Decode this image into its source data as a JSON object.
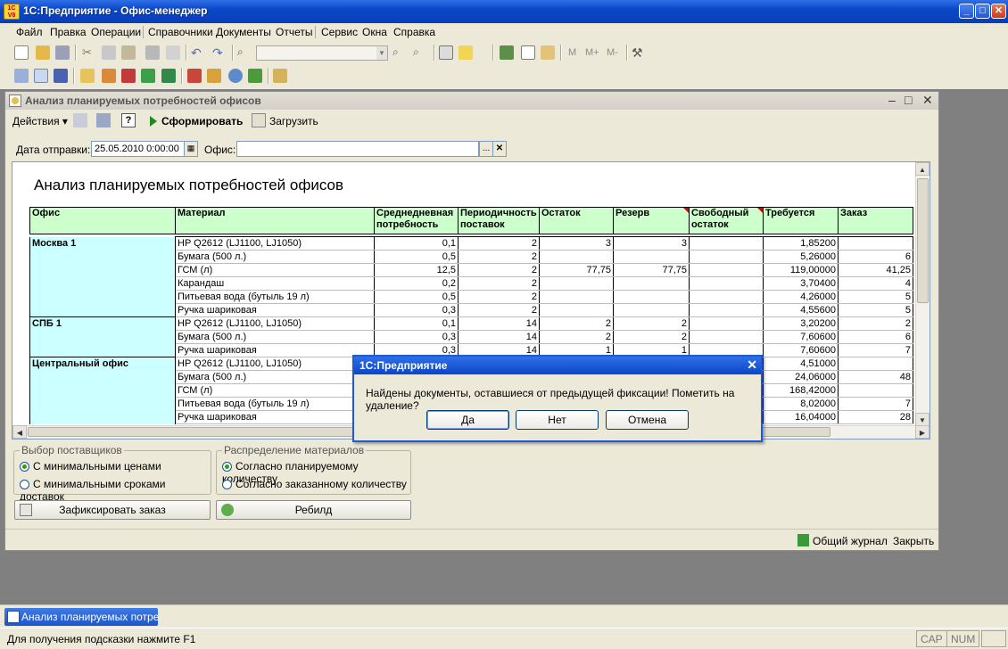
{
  "app": {
    "title": "1С:Предприятие - Офис-менеджер",
    "icon_text": "1С V8"
  },
  "menu": [
    "Файл",
    "Правка",
    "Операции",
    "Справочники",
    "Документы",
    "Отчеты",
    "Сервис",
    "Окна",
    "Справка"
  ],
  "toolbar": {
    "m_labels": [
      "M",
      "M+",
      "M-"
    ]
  },
  "window": {
    "title": "Анализ планируемых потребностей офисов",
    "toolbar": {
      "actions": "Действия",
      "generate": "Сформировать",
      "load": "Загрузить",
      "help": "?"
    },
    "filters": {
      "date_label": "Дата отправки:",
      "date_value": "25.05.2010  0:00:00",
      "office_label": "Офис:",
      "office_value": ""
    }
  },
  "report": {
    "title": "Анализ планируемых потребностей офисов",
    "columns": [
      "Офис",
      "Материал",
      "Среднедневная потребность",
      "Периодичность поставок",
      "Остаток",
      "Резерв",
      "Свободный остаток",
      "Требуется",
      "Заказ"
    ],
    "rows": [
      {
        "office": "Москва 1",
        "cells": [
          "HP Q2612 (LJ1100, LJ1050)",
          "0,1",
          "2",
          "3",
          "3",
          "",
          "1,85200",
          ""
        ]
      },
      {
        "office": "",
        "cells": [
          "Бумага (500 л.)",
          "0,5",
          "2",
          "",
          "",
          "",
          "5,26000",
          "6"
        ]
      },
      {
        "office": "",
        "cells": [
          "ГСМ (л)",
          "12,5",
          "2",
          "77,75",
          "77,75",
          "",
          "119,00000",
          "41,25"
        ]
      },
      {
        "office": "",
        "cells": [
          "Карандаш",
          "0,2",
          "2",
          "",
          "",
          "",
          "3,70400",
          "4"
        ]
      },
      {
        "office": "",
        "cells": [
          "Питьевая вода (бутыль 19 л)",
          "0,5",
          "2",
          "",
          "",
          "",
          "4,26000",
          "5"
        ]
      },
      {
        "office": "",
        "cells": [
          "Ручка шариковая",
          "0,3",
          "2",
          "",
          "",
          "",
          "4,55600",
          "5"
        ]
      },
      {
        "office": "СПБ 1",
        "cells": [
          "HP Q2612 (LJ1100, LJ1050)",
          "0,1",
          "14",
          "2",
          "2",
          "",
          "3,20200",
          "2"
        ]
      },
      {
        "office": "",
        "cells": [
          "Бумага (500 л.)",
          "0,3",
          "14",
          "2",
          "2",
          "",
          "7,60600",
          "6"
        ]
      },
      {
        "office": "",
        "cells": [
          "Ручка шариковая",
          "0,3",
          "14",
          "1",
          "1",
          "",
          "7,60600",
          "7"
        ]
      },
      {
        "office": "Центральный офис",
        "cells": [
          "HP Q2612 (LJ1100, LJ1050)",
          "",
          "",
          "",
          "",
          "",
          "4,51000",
          ""
        ]
      },
      {
        "office": "",
        "cells": [
          "Бумага (500 л.)",
          "",
          "",
          "",
          "",
          "",
          "24,06000",
          "48"
        ]
      },
      {
        "office": "",
        "cells": [
          "ГСМ (л)",
          "",
          "",
          "",
          "",
          "",
          "168,42000",
          ""
        ]
      },
      {
        "office": "",
        "cells": [
          "Питьевая вода (бутыль 19 л)",
          "",
          "",
          "",
          "",
          "",
          "8,02000",
          "7"
        ]
      },
      {
        "office": "",
        "cells": [
          "Ручка шариковая",
          "",
          "",
          "",
          "",
          "",
          "16,04000",
          "28"
        ]
      }
    ]
  },
  "suppliers": {
    "title": "Выбор поставщиков",
    "opt1": "С минимальными ценами",
    "opt2": "С минимальными сроками доставок"
  },
  "distribution": {
    "title": "Распределение материалов",
    "opt1": "Согласно планируемому количеству",
    "opt2": "Согласно заказанному количеству"
  },
  "buttons": {
    "fix_order": "Зафиксировать заказ",
    "rebuild": "Ребилд"
  },
  "window_status": {
    "journal": "Общий журнал",
    "close": "Закрыть"
  },
  "dialog": {
    "title": "1С:Предприятие",
    "message": "Найдены документы, оставшиеся от предыдущей фиксации! Пометить на удаление?",
    "yes": "Да",
    "no": "Нет",
    "cancel": "Отмена"
  },
  "taskbar": {
    "item": "Анализ планируемых потре..."
  },
  "status": {
    "hint": "Для получения подсказки нажмите F1",
    "cap": "CAP",
    "num": "NUM"
  }
}
